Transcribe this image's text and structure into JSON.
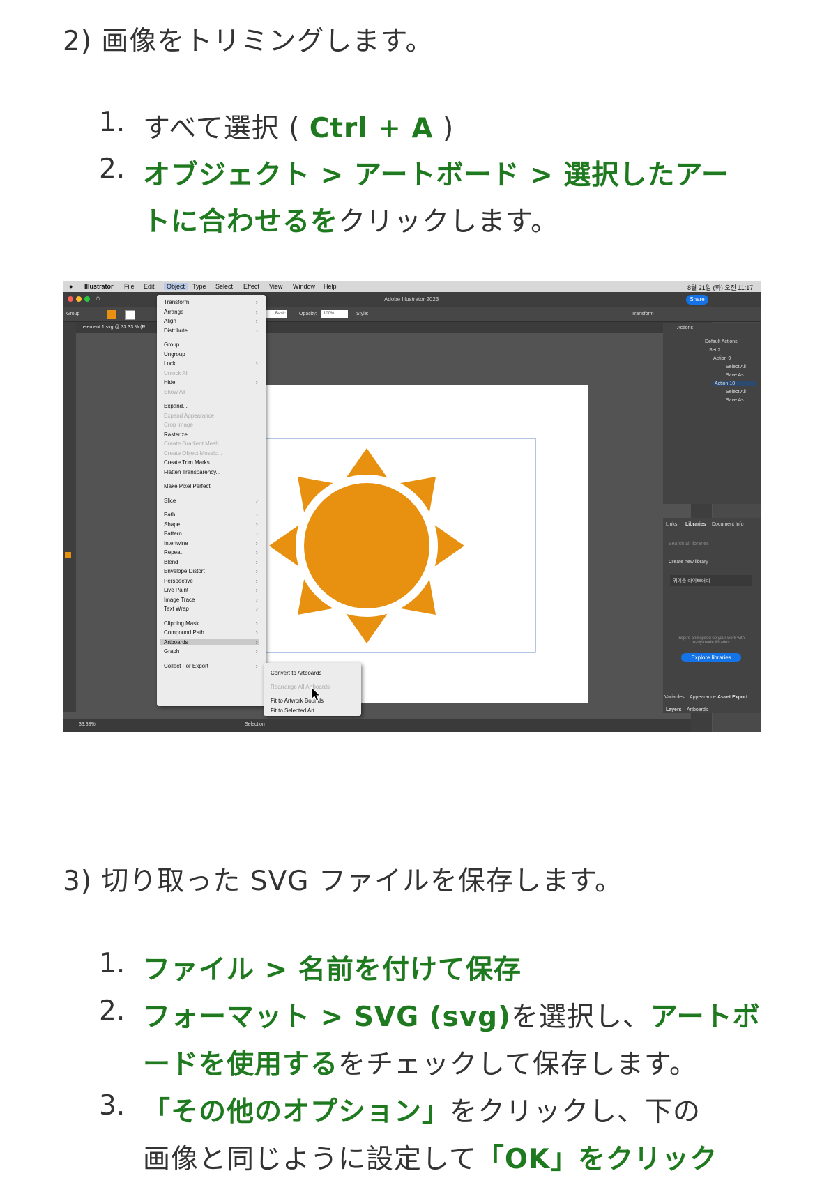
{
  "section2": {
    "heading": "2) 画像をトリミングします。",
    "step1_prefix": "すべて選択 ( ",
    "step1_key": "Ctrl + A",
    "step1_suffix": " )",
    "step2_line1": "オブジェクト > アートボード > 選択したアー",
    "step2_line2_bold": "トに合わせるを",
    "step2_line2_rest": "クリックします。"
  },
  "screenshot": {
    "mac_menu": [
      "Illustrator",
      "File",
      "Edit",
      "Object",
      "Type",
      "Select",
      "Effect",
      "View",
      "Window",
      "Help"
    ],
    "clock": "8월 21일 (화) 오전 11:17",
    "window_title": "Adobe Illustrator 2023",
    "share_label": "Share",
    "doc_tab": "element 1.svg @ 33.33 % (R",
    "ctrl_group": "Group",
    "ctrl_opacity": "Opacity:",
    "ctrl_opacity_val": "100%",
    "ctrl_style": "Style:",
    "ctrl_basic": "Basic",
    "ctrl_transform": "Transform",
    "menu_items": [
      "Transform",
      "Arrange",
      "Align",
      "Distribute",
      "Group",
      "Ungroup",
      "Lock",
      "Unlock All",
      "Hide",
      "Show All",
      "Expand...",
      "Expand Appearance",
      "Crop Image",
      "Rasterize...",
      "Create Gradient Mesh...",
      "Create Object Mosaic...",
      "Create Trim Marks",
      "Flatten Transparency...",
      "Make Pixel Perfect",
      "Slice",
      "Path",
      "Shape",
      "Pattern",
      "Intertwine",
      "Repeat",
      "Blend",
      "Envelope Distort",
      "Perspective",
      "Live Paint",
      "Image Trace",
      "Text Wrap",
      "Clipping Mask",
      "Compound Path",
      "Artboards",
      "Graph",
      "Collect For Export"
    ],
    "submenu_items": [
      "Convert to Artboards",
      "Rearrange All Artboards",
      "Fit to Artwork Bounds",
      "Fit to Selected Art"
    ],
    "actions_title": "Actions",
    "actions": [
      "Default Actions",
      "Set 2",
      "Action 9",
      "Select All",
      "Save As",
      "Action 10",
      "Select All",
      "Save As"
    ],
    "lib_tabs": [
      "Links",
      "Libraries",
      "Document Info"
    ],
    "lib_search": "Search all libraries",
    "create_library": "Create new library",
    "lib_name": "귀여운 라이브러리",
    "lib_hint": "Inspire and speed up your work with ready-made libraries.",
    "explore_label": "Explore libraries",
    "bottom_tabs": [
      "Variables",
      "Appearance",
      "Asset Export"
    ],
    "bottom_tabs2": [
      "Layers",
      "Artboards"
    ],
    "zoom": "33.33%",
    "status": "Selection",
    "sun_color": "#e8900f"
  },
  "section3": {
    "heading": "3) 切り取った SVG ファイルを保存します。",
    "step1": "ファイル > 名前を付けて保存",
    "step2_bold1": "フォーマット > SVG (svg)",
    "step2_mid": "を選択し、",
    "step2_bold2a": "アートボ",
    "step2_bold2b": "ードを使用する",
    "step2_rest": "をチェックして保存します。",
    "step3_bold": "「その他のオプション」",
    "step3_mid": "をクリックし、下の",
    "step3_line2_pre": "画像と同じように設定して",
    "step3_line2_bold": "「OK」をクリック"
  },
  "numbers": [
    "1.",
    "2.",
    "3."
  ]
}
